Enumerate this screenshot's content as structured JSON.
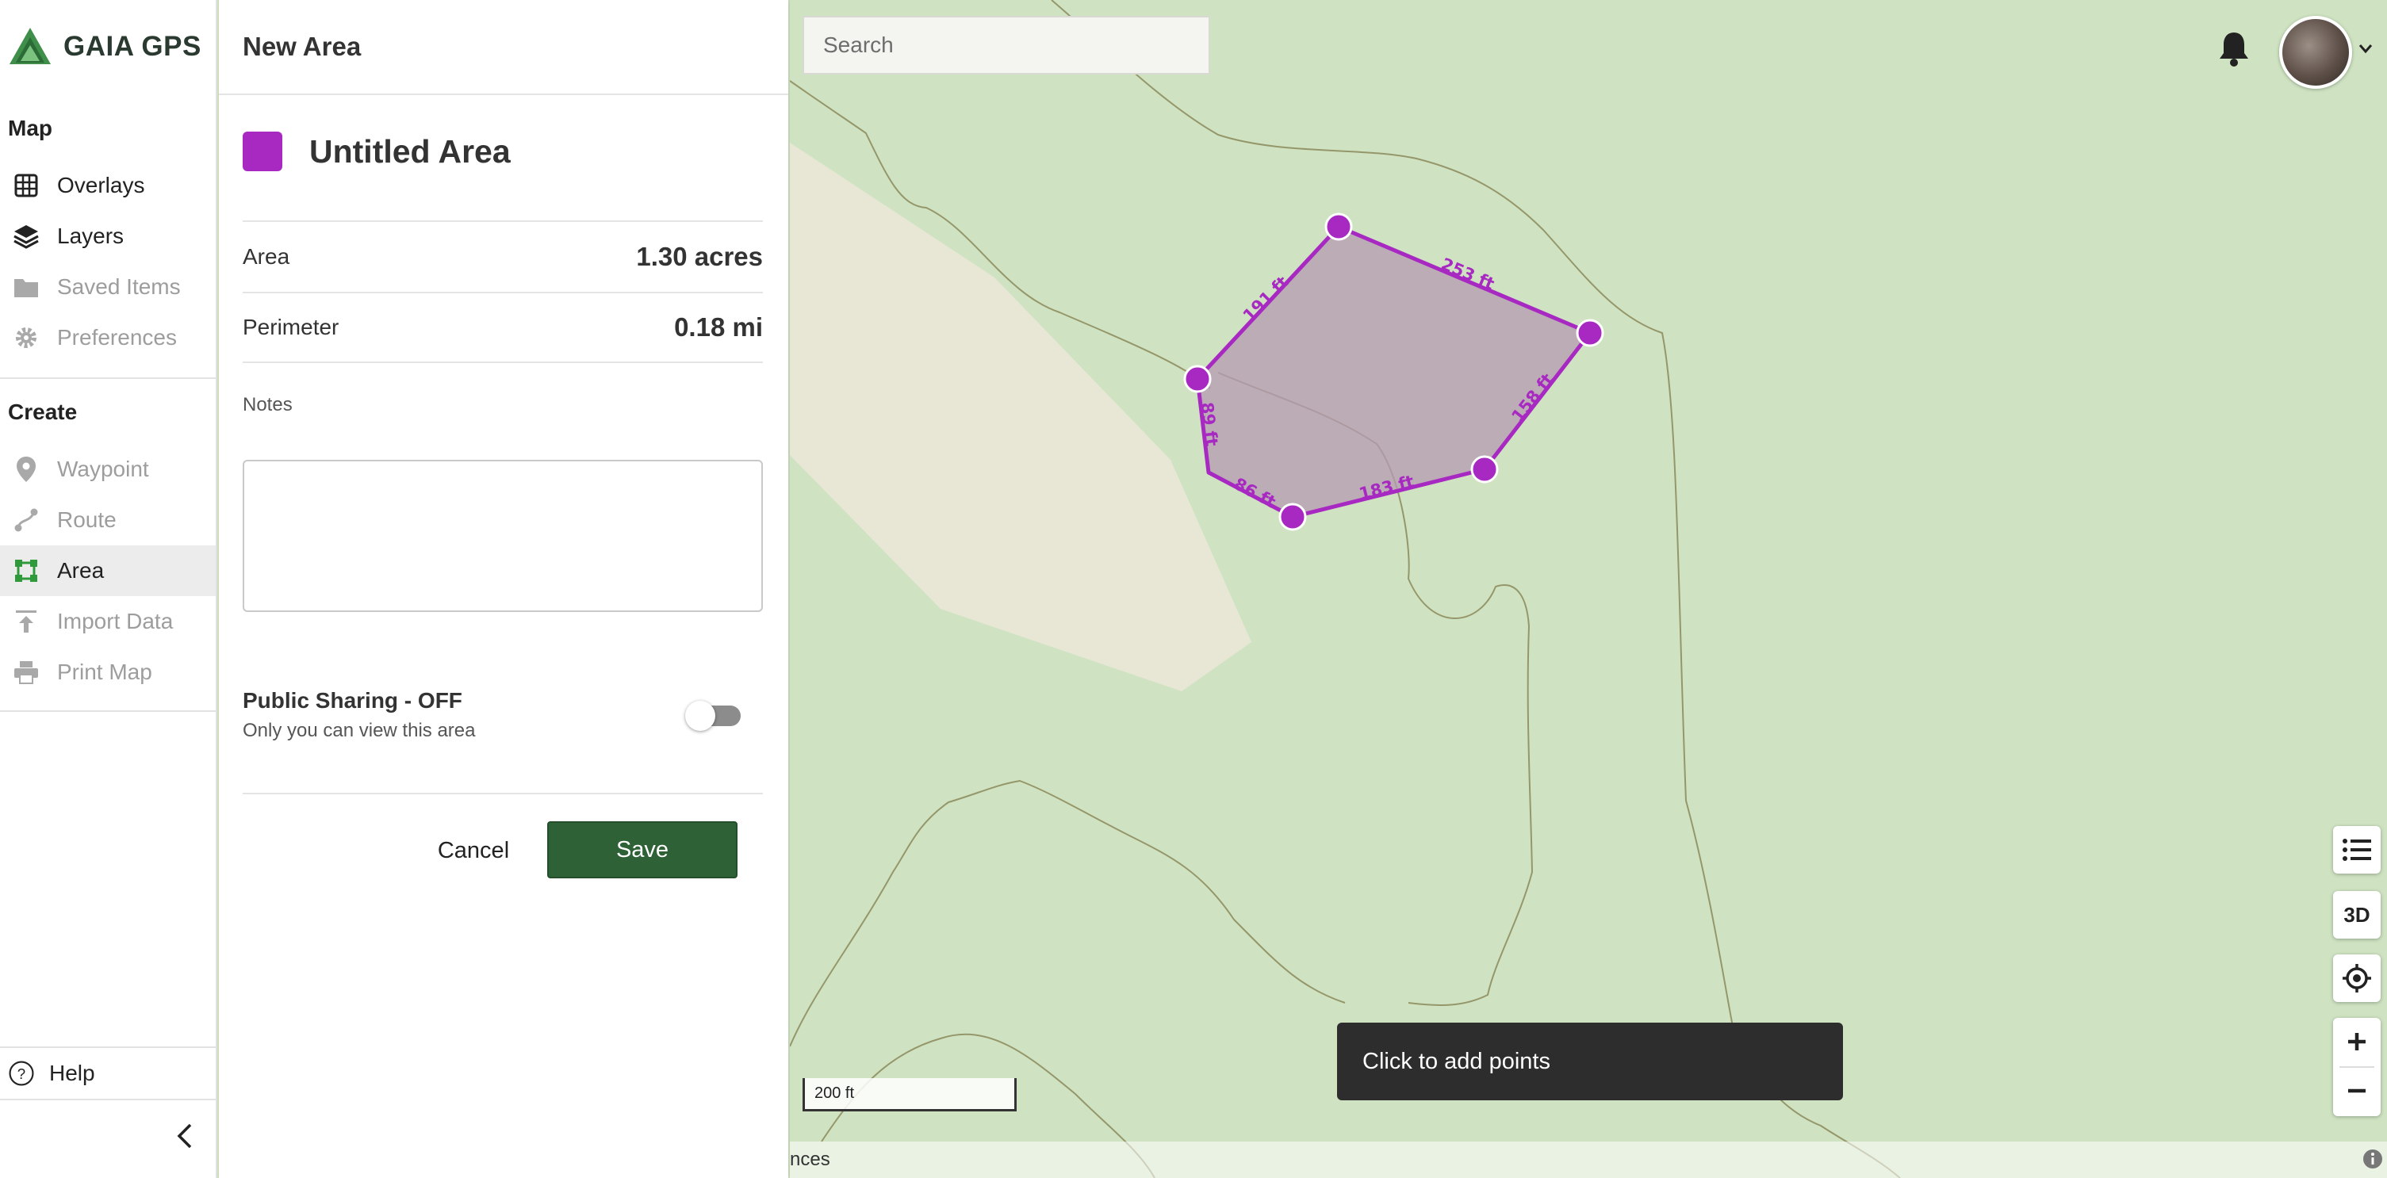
{
  "app": {
    "logo_text": "GAIA GPS"
  },
  "sidebar": {
    "map_section": "Map",
    "map_items": [
      {
        "label": "Overlays",
        "icon": "overlays-icon",
        "enabled": true
      },
      {
        "label": "Layers",
        "icon": "layers-icon",
        "enabled": true
      },
      {
        "label": "Saved Items",
        "icon": "folder-icon",
        "enabled": false
      },
      {
        "label": "Preferences",
        "icon": "gear-icon",
        "enabled": false
      }
    ],
    "create_section": "Create",
    "create_items": [
      {
        "label": "Waypoint",
        "icon": "pin-icon",
        "enabled": false
      },
      {
        "label": "Route",
        "icon": "route-icon",
        "enabled": false
      },
      {
        "label": "Area",
        "icon": "area-icon",
        "enabled": true,
        "active": true
      },
      {
        "label": "Import Data",
        "icon": "upload-icon",
        "enabled": false
      },
      {
        "label": "Print Map",
        "icon": "printer-icon",
        "enabled": false
      }
    ],
    "help_label": "Help"
  },
  "panel": {
    "title": "New Area",
    "area_name": "Untitled Area",
    "area_color": "#a729c2",
    "area_label": "Area",
    "area_value": "1.30 acres",
    "perimeter_label": "Perimeter",
    "perimeter_value": "0.18 mi",
    "notes_label": "Notes",
    "notes_value": "",
    "sharing_title": "Public Sharing - OFF",
    "sharing_subtitle": "Only you can view this area",
    "sharing_on": false,
    "cancel_label": "Cancel",
    "save_label": "Save",
    "save_color": "#2e6135"
  },
  "map": {
    "search_placeholder": "Search",
    "toast": "Click to add points",
    "scale_label": "200 ft",
    "attribution": "nces",
    "view_3d_label": "3D",
    "segment_labels": [
      "191 ft",
      "253 ft",
      "158 ft",
      "183 ft",
      "86 ft",
      "89 ft"
    ],
    "colors": {
      "land": "#cfe3c2",
      "clearing": "#e8e7d6",
      "polygon": "#a729c2",
      "contour": "#8b8a5c"
    }
  }
}
